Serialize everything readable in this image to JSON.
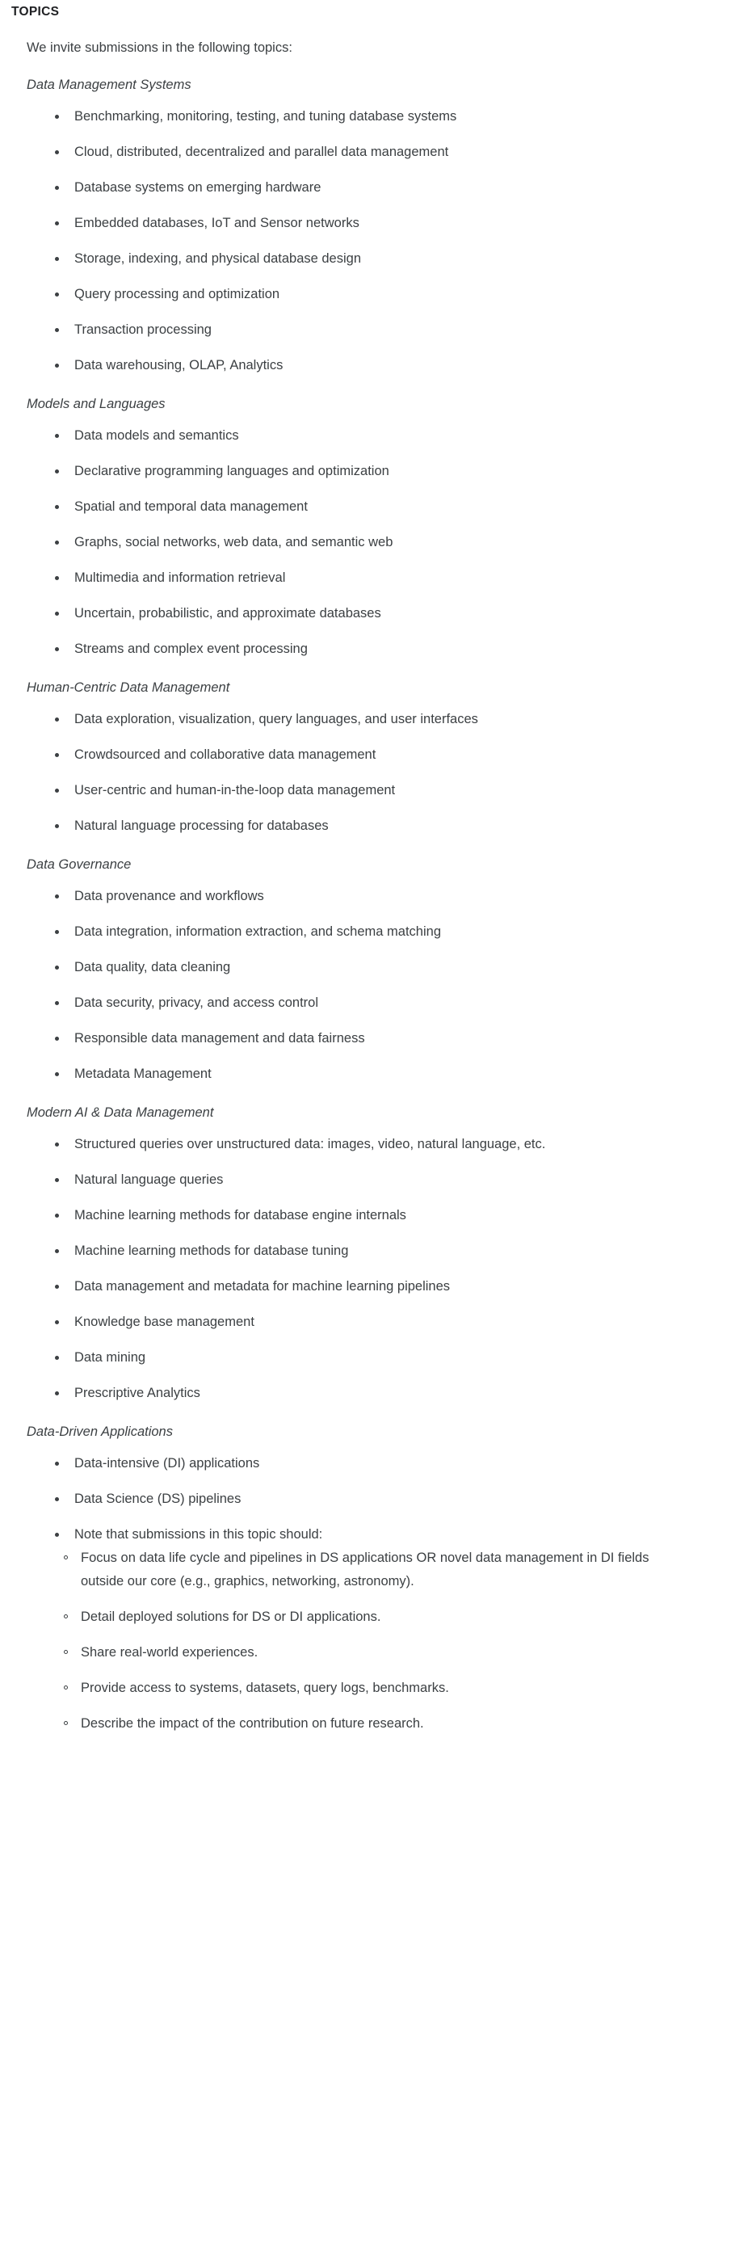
{
  "page": {
    "title": "TOPICS",
    "intro": "We invite submissions in the following topics:"
  },
  "sections": [
    {
      "heading": "Data Management Systems",
      "items": [
        "Benchmarking, monitoring, testing, and tuning database systems",
        "Cloud, distributed, decentralized and parallel data management",
        "Database systems on emerging hardware",
        "Embedded databases, IoT and Sensor networks",
        "Storage, indexing, and physical database design",
        "Query processing and optimization",
        "Transaction processing",
        "Data warehousing, OLAP, Analytics"
      ]
    },
    {
      "heading": "Models and Languages",
      "items": [
        "Data models and semantics",
        "Declarative programming languages and optimization",
        "Spatial and temporal data management",
        "Graphs, social networks, web data, and semantic web",
        "Multimedia and information retrieval",
        "Uncertain, probabilistic, and approximate databases",
        "Streams and complex event processing"
      ]
    },
    {
      "heading": "Human-Centric Data Management",
      "items": [
        "Data exploration, visualization, query languages, and user interfaces",
        "Crowdsourced and collaborative data management",
        "User-centric and human-in-the-loop data management",
        "Natural language processing for databases"
      ]
    },
    {
      "heading": "Data Governance",
      "items": [
        "Data provenance and workflows",
        "Data integration, information extraction, and schema matching",
        "Data quality, data cleaning",
        "Data security, privacy, and access control",
        "Responsible data management and data fairness",
        "Metadata Management"
      ]
    },
    {
      "heading": "Modern AI & Data Management",
      "items": [
        "Structured queries over unstructured data: images, video, natural language, etc.",
        "Natural language queries",
        "Machine learning methods for database engine internals",
        "Machine learning methods for database tuning",
        "Data management and metadata for machine learning pipelines",
        "Knowledge base management",
        "Data mining",
        "Prescriptive Analytics"
      ]
    },
    {
      "heading": "Data-Driven Applications",
      "items": [
        "Data-intensive (DI) applications",
        "Data Science (DS) pipelines",
        "Note that submissions in this topic should:"
      ],
      "sub_items": [
        "Focus on data life cycle and pipelines in DS applications OR novel data management in DI fields outside our core (e.g., graphics, networking, astronomy).",
        "Detail deployed solutions for DS or DI applications.",
        "Share real-world experiences.",
        "Provide access to systems, datasets, query logs, benchmarks.",
        "Describe the impact of the contribution on future research."
      ]
    }
  ]
}
